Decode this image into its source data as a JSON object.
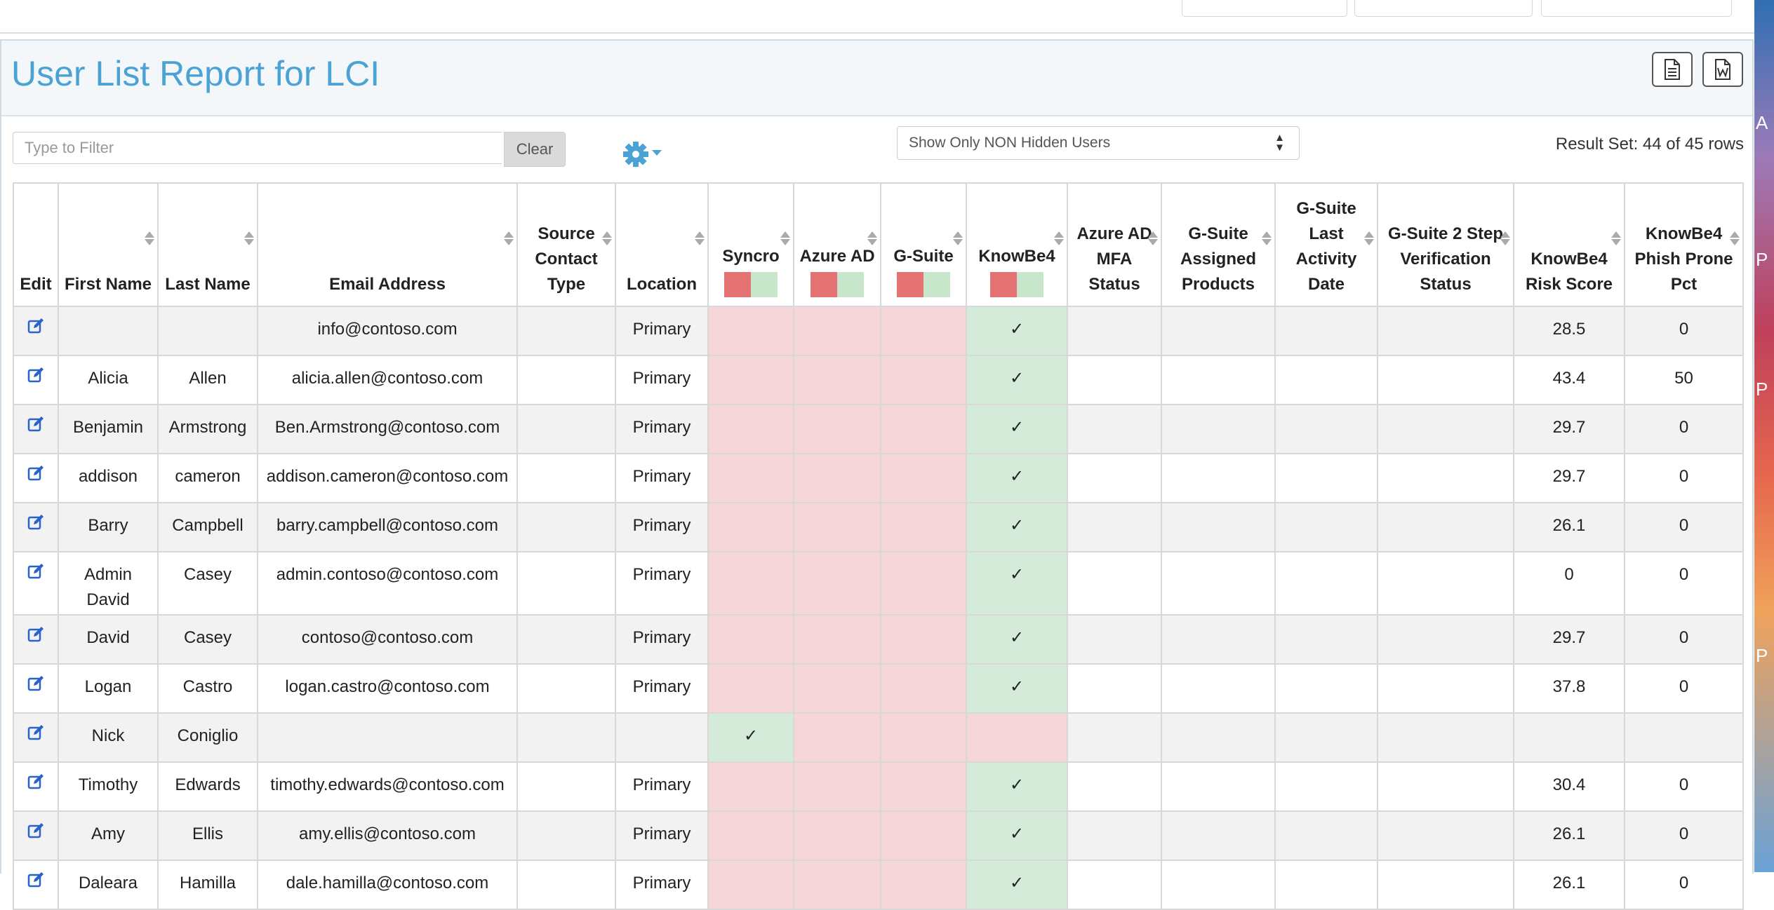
{
  "page": {
    "title": "User List Report for LCI",
    "filter_placeholder": "Type to Filter",
    "clear_label": "Clear",
    "visibility_select": "Show Only NON Hidden Users",
    "result_set": "Result Set: 44 of 45 rows",
    "accent_color": "#4aa3d4"
  },
  "icons": {
    "export": [
      "document-icon",
      "word-document-icon"
    ],
    "settings": "gear-icon",
    "edit": "edit-icon",
    "check": "✓"
  },
  "columns": [
    {
      "key": "edit",
      "label": "Edit"
    },
    {
      "key": "first",
      "label": "First Name"
    },
    {
      "key": "last",
      "label": "Last Name"
    },
    {
      "key": "email",
      "label": "Email Address"
    },
    {
      "key": "source",
      "label": "Source Contact Type"
    },
    {
      "key": "location",
      "label": "Location"
    },
    {
      "key": "syncro",
      "label": "Syncro"
    },
    {
      "key": "azure",
      "label": "Azure AD"
    },
    {
      "key": "gsuite",
      "label": "G-Suite"
    },
    {
      "key": "knowbe4",
      "label": "KnowBe4"
    },
    {
      "key": "mfa",
      "label": "Azure AD MFA Status"
    },
    {
      "key": "gs_products",
      "label": "G-Suite Assigned Products"
    },
    {
      "key": "gs_activity",
      "label": "G-Suite Last Activity Date"
    },
    {
      "key": "gs_2sv",
      "label": "G-Suite 2 Step Verification Status"
    },
    {
      "key": "risk",
      "label": "KnowBe4 Risk Score"
    },
    {
      "key": "phish",
      "label": "KnowBe4 Phish Prone Pct"
    }
  ],
  "rows": [
    {
      "first": "",
      "last": "",
      "email": "info@contoso.com",
      "location": "Primary",
      "syncro": false,
      "azure": false,
      "gsuite": false,
      "knowbe4": true,
      "risk": "28.5",
      "phish": "0"
    },
    {
      "first": "Alicia",
      "last": "Allen",
      "email": "alicia.allen@contoso.com",
      "location": "Primary",
      "syncro": false,
      "azure": false,
      "gsuite": false,
      "knowbe4": true,
      "risk": "43.4",
      "phish": "50"
    },
    {
      "first": "Benjamin",
      "last": "Armstrong",
      "email": "Ben.Armstrong@contoso.com",
      "location": "Primary",
      "syncro": false,
      "azure": false,
      "gsuite": false,
      "knowbe4": true,
      "risk": "29.7",
      "phish": "0"
    },
    {
      "first": "addison",
      "last": "cameron",
      "email": "addison.cameron@contoso.com",
      "location": "Primary",
      "syncro": false,
      "azure": false,
      "gsuite": false,
      "knowbe4": true,
      "risk": "29.7",
      "phish": "0"
    },
    {
      "first": "Barry",
      "last": "Campbell",
      "email": "barry.campbell@contoso.com",
      "location": "Primary",
      "syncro": false,
      "azure": false,
      "gsuite": false,
      "knowbe4": true,
      "risk": "26.1",
      "phish": "0"
    },
    {
      "first": "Admin David",
      "last": "Casey",
      "email": "admin.contoso@contoso.com",
      "location": "Primary",
      "syncro": false,
      "azure": false,
      "gsuite": false,
      "knowbe4": true,
      "risk": "0",
      "phish": "0",
      "tall": true
    },
    {
      "first": "David",
      "last": "Casey",
      "email": "contoso@contoso.com",
      "location": "Primary",
      "syncro": false,
      "azure": false,
      "gsuite": false,
      "knowbe4": true,
      "risk": "29.7",
      "phish": "0"
    },
    {
      "first": "Logan",
      "last": "Castro",
      "email": "logan.castro@contoso.com",
      "location": "Primary",
      "syncro": false,
      "azure": false,
      "gsuite": false,
      "knowbe4": true,
      "risk": "37.8",
      "phish": "0"
    },
    {
      "first": "Nick",
      "last": "Coniglio",
      "email": "",
      "location": "",
      "syncro": true,
      "azure": false,
      "gsuite": false,
      "knowbe4": false,
      "risk": "",
      "phish": ""
    },
    {
      "first": "Timothy",
      "last": "Edwards",
      "email": "timothy.edwards@contoso.com",
      "location": "Primary",
      "syncro": false,
      "azure": false,
      "gsuite": false,
      "knowbe4": true,
      "risk": "30.4",
      "phish": "0"
    },
    {
      "first": "Amy",
      "last": "Ellis",
      "email": "amy.ellis@contoso.com",
      "location": "Primary",
      "syncro": false,
      "azure": false,
      "gsuite": false,
      "knowbe4": true,
      "risk": "26.1",
      "phish": "0"
    },
    {
      "first": "Daleara",
      "last": "Hamilla",
      "email": "dale.hamilla@contoso.com",
      "location": "Primary",
      "syncro": false,
      "azure": false,
      "gsuite": false,
      "knowbe4": true,
      "risk": "26.1",
      "phish": "0"
    }
  ]
}
